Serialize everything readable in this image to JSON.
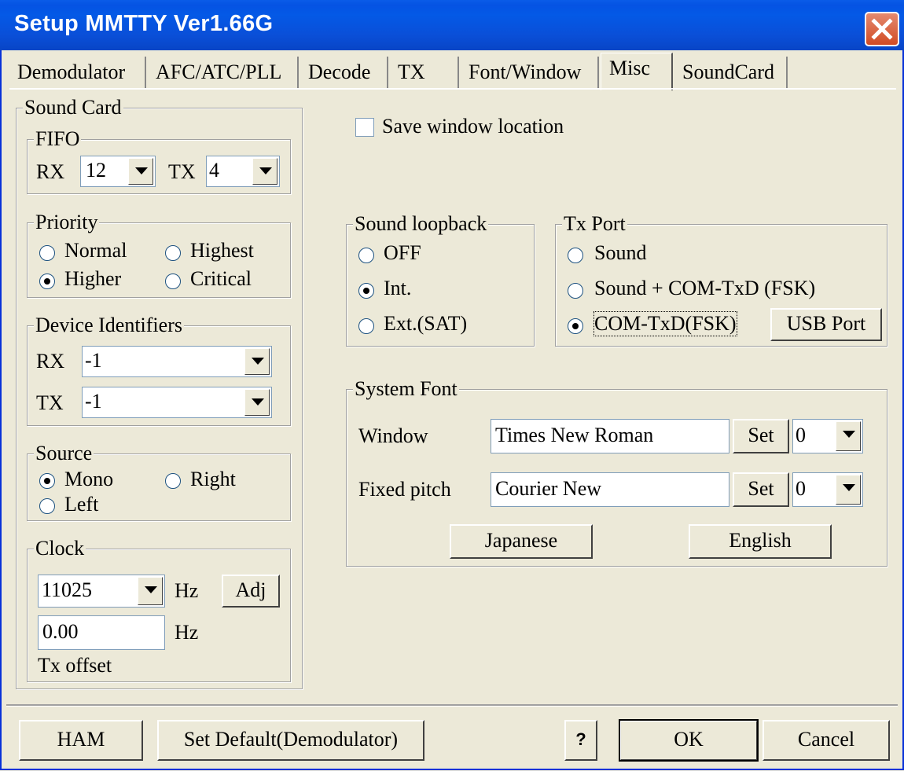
{
  "window": {
    "title": "Setup MMTTY Ver1.66G"
  },
  "tabs": [
    {
      "label": "Demodulator"
    },
    {
      "label": "AFC/ATC/PLL"
    },
    {
      "label": "Decode"
    },
    {
      "label": "TX"
    },
    {
      "label": "Font/Window"
    },
    {
      "label": "Misc"
    },
    {
      "label": "SoundCard"
    }
  ],
  "active_tab": "Misc",
  "sound_card": {
    "title": "Sound Card",
    "fifo": {
      "title": "FIFO",
      "rx_label": "RX",
      "rx_value": "12",
      "tx_label": "TX",
      "tx_value": "4"
    },
    "priority": {
      "title": "Priority",
      "normal": "Normal",
      "highest": "Highest",
      "higher": "Higher",
      "critical": "Critical",
      "selected": "Higher"
    },
    "device": {
      "title": "Device Identifiers",
      "rx_label": "RX",
      "rx_value": "-1",
      "tx_label": "TX",
      "tx_value": "-1"
    },
    "source": {
      "title": "Source",
      "mono": "Mono",
      "right": "Right",
      "left": "Left",
      "selected": "Mono"
    },
    "clock": {
      "title": "Clock",
      "rate": "11025",
      "hz1": "Hz",
      "adj": "Adj",
      "offset": "0.00",
      "hz2": "Hz",
      "tx_offset": "Tx offset"
    }
  },
  "save_window": {
    "label": "Save window location",
    "checked": false
  },
  "loopback": {
    "title": "Sound loopback",
    "off": "OFF",
    "int": "Int.",
    "ext": "Ext.(SAT)",
    "selected": "Int."
  },
  "txport": {
    "title": "Tx Port",
    "sound": "Sound",
    "sound_com": "Sound + COM-TxD (FSK)",
    "com": "COM-TxD(FSK)",
    "usb": "USB Port",
    "selected": "COM-TxD(FSK)"
  },
  "system_font": {
    "title": "System Font",
    "window_label": "Window",
    "window_font": "Times New Roman",
    "window_set": "Set",
    "window_size": "0",
    "fixed_label": "Fixed pitch",
    "fixed_font": "Courier New",
    "fixed_set": "Set",
    "fixed_size": "0",
    "japanese": "Japanese",
    "english": "English"
  },
  "buttons": {
    "ham": "HAM",
    "set_default": "Set Default(Demodulator)",
    "help": "?",
    "ok": "OK",
    "cancel": "Cancel"
  }
}
